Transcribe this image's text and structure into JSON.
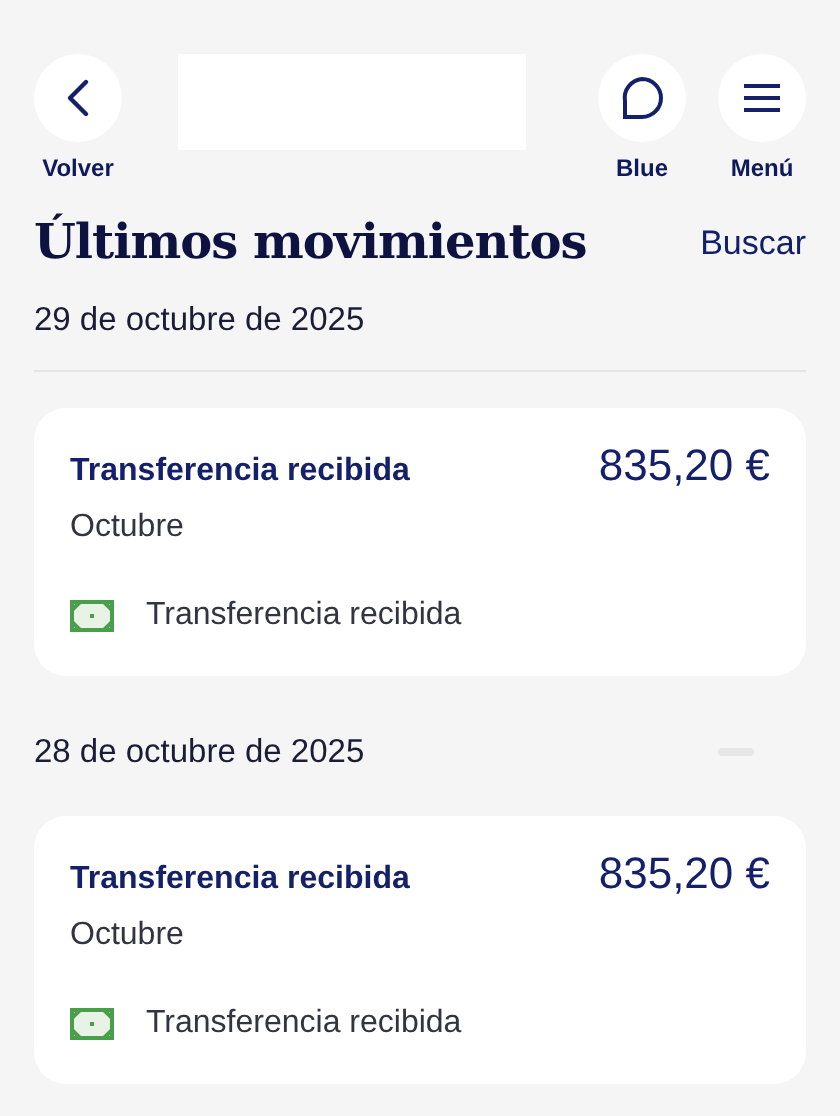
{
  "header": {
    "buttons": [
      {
        "kind": "back",
        "label": "Volver"
      },
      {
        "kind": "chat",
        "label": "Blue"
      },
      {
        "kind": "menu",
        "label": "Menú"
      }
    ]
  },
  "title": "Últimos movimientos",
  "search_link": "Buscar",
  "groups": [
    {
      "date": "29 de octubre de 2025",
      "movements": [
        {
          "title": "Transferencia recibida",
          "amount": "835,20 €",
          "concept": "Octubre",
          "category": "Transferencia recibida"
        }
      ]
    },
    {
      "date": "28 de octubre de 2025",
      "movements": [
        {
          "title": "Transferencia recibida",
          "amount": "835,20 €",
          "concept": "Octubre",
          "category": "Transferencia recibida"
        }
      ]
    }
  ]
}
